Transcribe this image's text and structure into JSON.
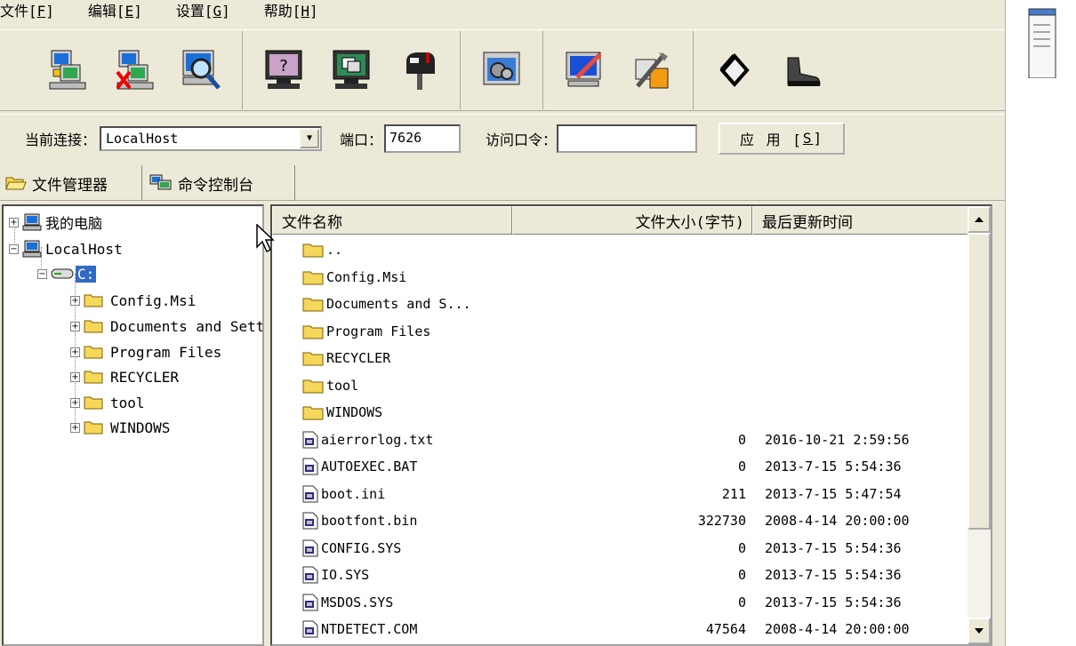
{
  "menu": {
    "items": [
      {
        "label": "文件[",
        "key": "F",
        "end": "]"
      },
      {
        "label": "编辑[",
        "key": "E",
        "end": "]"
      },
      {
        "label": "设置[",
        "key": "G",
        "end": "]"
      },
      {
        "label": "帮助[",
        "key": "H",
        "end": "]"
      }
    ]
  },
  "toolbar": {
    "icons": [
      "connect-computer-icon",
      "disconnect-computer-icon",
      "search-computer-icon",
      "help-monitor-icon",
      "screen-monitor-icon",
      "mailbox-icon",
      "settings-gear-icon",
      "edit-monitor-icon",
      "tools-icon",
      "back-arrow-icon",
      "boot-icon"
    ]
  },
  "connection": {
    "current_label": "当前连接：",
    "current_value": "LocalHost",
    "port_label": "端口：",
    "port_value": "7626",
    "password_label": "访问口令：",
    "password_value": "",
    "apply_label": "应 用 [",
    "apply_key": "S",
    "apply_end": "]"
  },
  "tabs": {
    "file_manager": "文件管理器",
    "command_console": "命令控制台"
  },
  "tree": {
    "my_computer": "我的电脑",
    "localhost": "LocalHost",
    "drive": "C:",
    "folders": [
      "Config.Msi",
      "Documents and Settings",
      "Program Files",
      "RECYCLER",
      "tool",
      "WINDOWS"
    ]
  },
  "list": {
    "columns": {
      "name": "文件名称",
      "size": "文件大小(字节)",
      "modified": "最后更新时间"
    },
    "rows": [
      {
        "name": "..",
        "size": "",
        "modified": "",
        "type": "folder"
      },
      {
        "name": "Config.Msi",
        "size": "",
        "modified": "",
        "type": "folder"
      },
      {
        "name": "Documents and S...",
        "size": "",
        "modified": "",
        "type": "folder"
      },
      {
        "name": "Program Files",
        "size": "",
        "modified": "",
        "type": "folder"
      },
      {
        "name": "RECYCLER",
        "size": "",
        "modified": "",
        "type": "folder"
      },
      {
        "name": "tool",
        "size": "",
        "modified": "",
        "type": "folder"
      },
      {
        "name": "WINDOWS",
        "size": "",
        "modified": "",
        "type": "folder"
      },
      {
        "name": "aierrorlog.txt",
        "size": "0",
        "modified": "2016-10-21 2:59:56",
        "type": "file"
      },
      {
        "name": "AUTOEXEC.BAT",
        "size": "0",
        "modified": "2013-7-15 5:54:36",
        "type": "file"
      },
      {
        "name": "boot.ini",
        "size": "211",
        "modified": "2013-7-15 5:47:54",
        "type": "file"
      },
      {
        "name": "bootfont.bin",
        "size": "322730",
        "modified": "2008-4-14 20:00:00",
        "type": "file"
      },
      {
        "name": "CONFIG.SYS",
        "size": "0",
        "modified": "2013-7-15 5:54:36",
        "type": "file"
      },
      {
        "name": "IO.SYS",
        "size": "0",
        "modified": "2013-7-15 5:54:36",
        "type": "file"
      },
      {
        "name": "MSDOS.SYS",
        "size": "0",
        "modified": "2013-7-15 5:54:36",
        "type": "file"
      },
      {
        "name": "NTDETECT.COM",
        "size": "47564",
        "modified": "2008-4-14 20:00:00",
        "type": "file"
      }
    ]
  },
  "colors": {
    "window_bg": "#ece9d8",
    "selection": "#316ac5",
    "folder": "#f5d75a"
  }
}
